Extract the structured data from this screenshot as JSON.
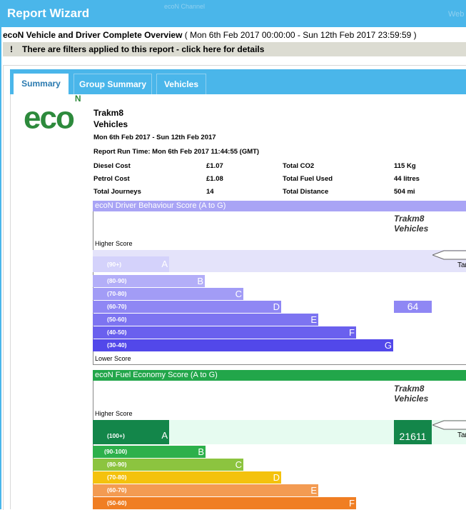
{
  "window": {
    "title": "Report Wizard",
    "ghost_text": "ecoN Channel",
    "ghost_right": "Web"
  },
  "report": {
    "title": "ecoN Vehicle and Driver Complete Overview",
    "period": "( Mon 6th Feb 2017 00:00:00 - Sun 12th Feb 2017 23:59:59 )",
    "filter_icon": "!",
    "filter_notice": "There are filters applied to this report - click here for details"
  },
  "tabs": [
    {
      "label": "Summary",
      "active": true
    },
    {
      "label": "Group Summary",
      "active": false
    },
    {
      "label": "Vehicles",
      "active": false
    }
  ],
  "logo": {
    "text": "eco",
    "sup": "N"
  },
  "summary": {
    "company": "Trakm8",
    "entity": "Vehicles",
    "date_range": "Mon 6th Feb 2017 - Sun 12th Feb 2017",
    "run_time": "Report Run Time: Mon 6th Feb 2017 11:44:55 (GMT)",
    "stats": [
      {
        "label": "Diesel Cost",
        "value": "£1.07",
        "label2": "Total CO2",
        "value2": "115 Kg"
      },
      {
        "label": "Petrol Cost",
        "value": "£1.08",
        "label2": "Total Fuel Used",
        "value2": "44 litres"
      },
      {
        "label": "Total Journeys",
        "value": "14",
        "label2": "Total Distance",
        "value2": "504 mi"
      }
    ]
  },
  "driver_behaviour": {
    "title": "ecoN Driver Behaviour Score (A to G)",
    "entity_line1": "Trakm8",
    "entity_line2": "Vehicles",
    "higher": "Higher Score",
    "lower": "Lower Score",
    "target_label": "Target",
    "value": "64",
    "header_color": "#a9a4f5",
    "bands": [
      {
        "range": "(90+)",
        "letter": "A",
        "color": "#d4d2fb"
      },
      {
        "range": "(80-90)",
        "letter": "B",
        "color": "#b3aef8"
      },
      {
        "range": "(70-80)",
        "letter": "C",
        "color": "#a29cf6"
      },
      {
        "range": "(60-70)",
        "letter": "D",
        "color": "#8f87f4"
      },
      {
        "range": "(50-60)",
        "letter": "E",
        "color": "#7d74f1"
      },
      {
        "range": "(40-50)",
        "letter": "F",
        "color": "#6a60ee"
      },
      {
        "range": "(30-40)",
        "letter": "G",
        "color": "#5248ea"
      }
    ]
  },
  "fuel_economy": {
    "title": "ecoN Fuel Economy Score (A to G)",
    "entity_line1": "Trakm8",
    "entity_line2": "Vehicles",
    "higher": "Higher Score",
    "target_label": "Target",
    "value": "21611",
    "header_color": "#22a64a",
    "bands": [
      {
        "range": "(100+)",
        "letter": "A",
        "color": "#13864a"
      },
      {
        "range": "(90-100)",
        "letter": "B",
        "color": "#2db04b"
      },
      {
        "range": "(80-90)",
        "letter": "C",
        "color": "#8cc43f"
      },
      {
        "range": "(70-80)",
        "letter": "D",
        "color": "#f4c20d"
      },
      {
        "range": "(60-70)",
        "letter": "E",
        "color": "#f39b52"
      },
      {
        "range": "(50-60)",
        "letter": "F",
        "color": "#f07e23"
      }
    ]
  }
}
